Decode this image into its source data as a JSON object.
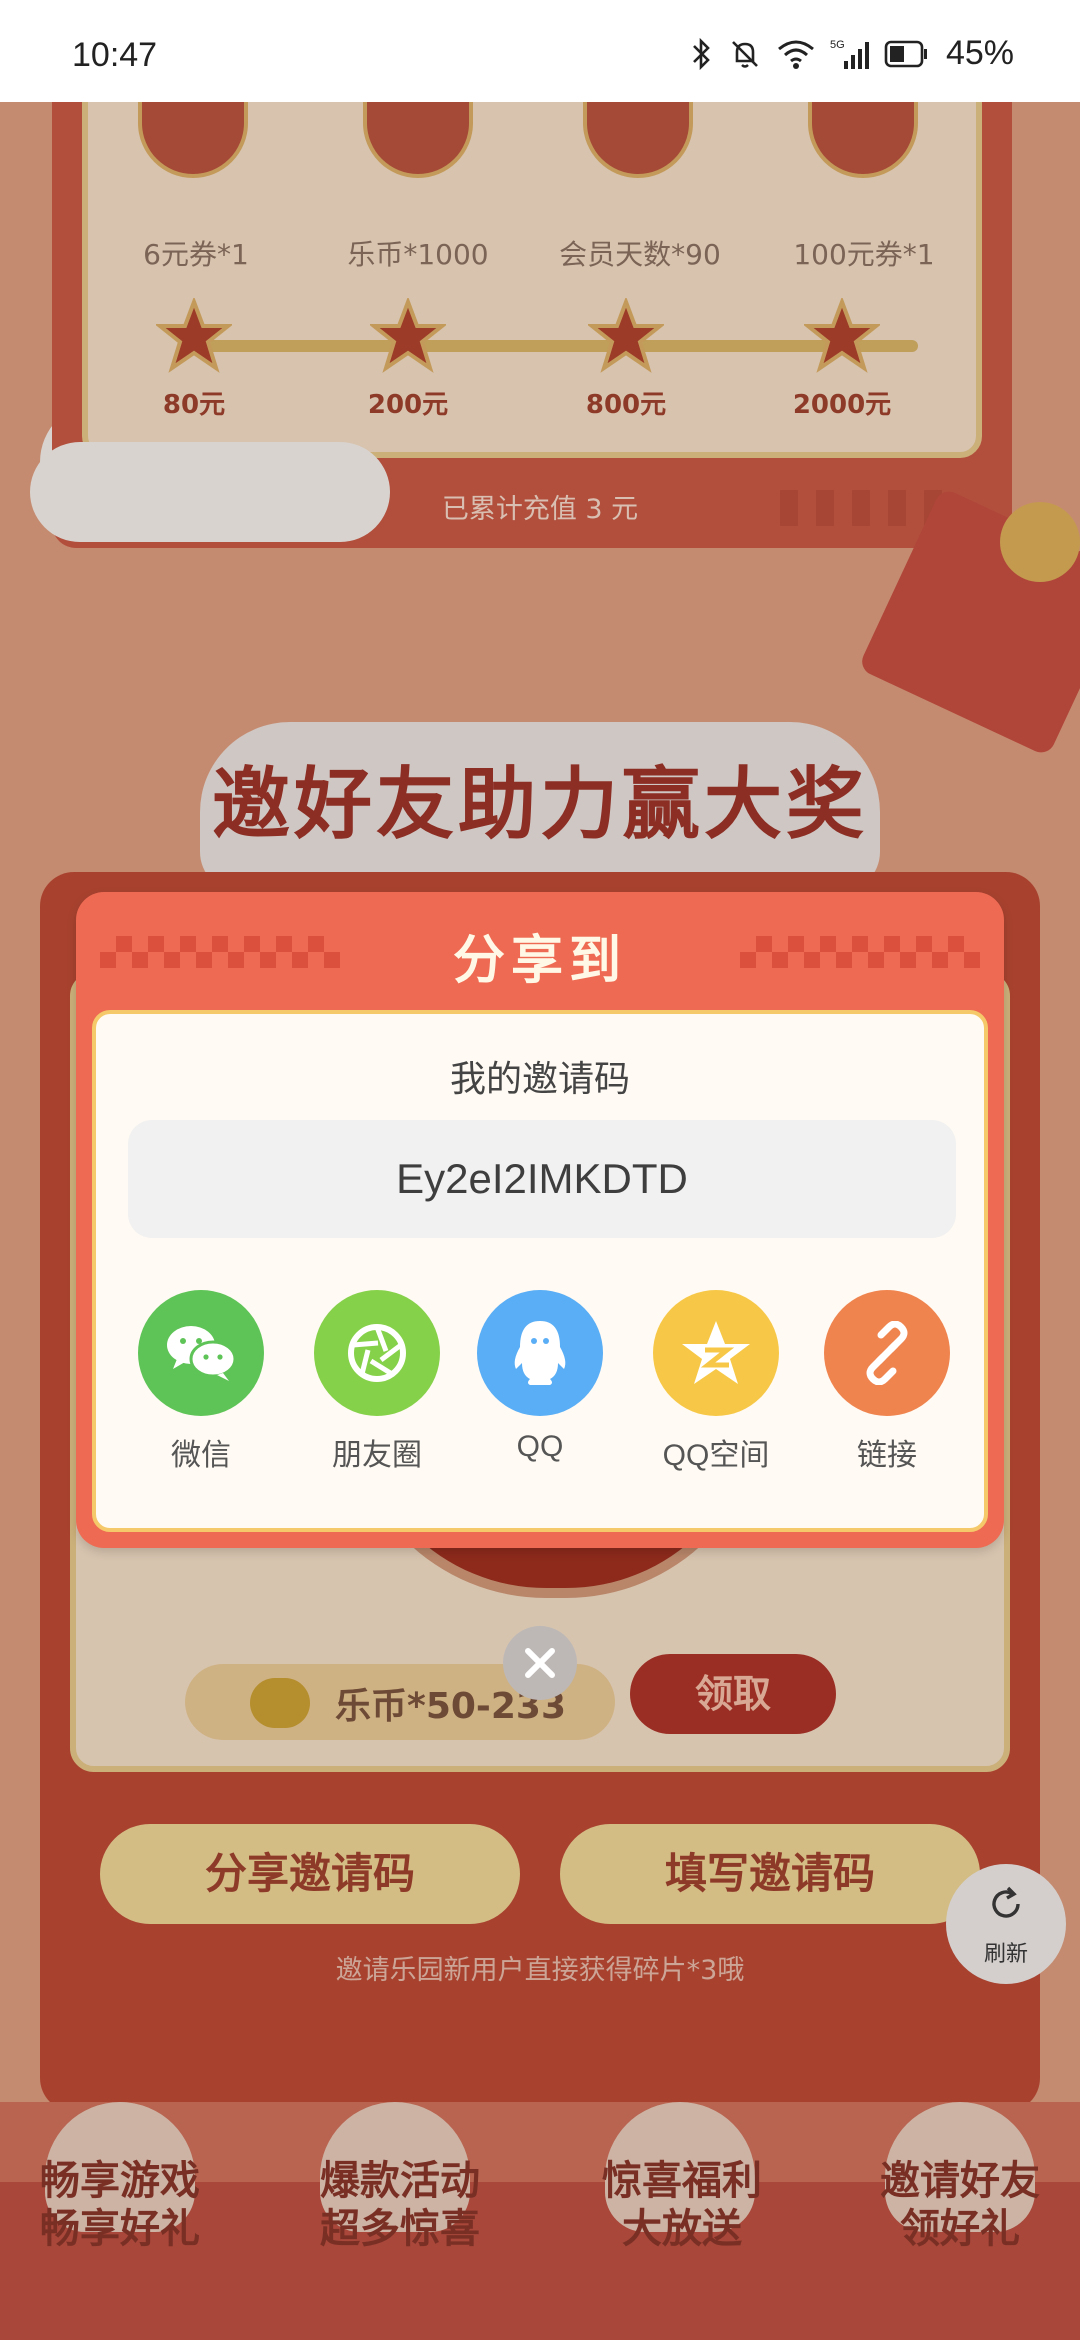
{
  "status_bar": {
    "time": "10:47",
    "battery": "45%",
    "network": "5G"
  },
  "background": {
    "rewards": [
      {
        "label": "6元券*1"
      },
      {
        "label": "乐币*1000"
      },
      {
        "label": "会员天数*90"
      },
      {
        "label": "100元券*1"
      }
    ],
    "milestones": [
      "80元",
      "200元",
      "800元",
      "2000元"
    ],
    "accumulated_text": "已累计充值 3 元",
    "section_title": "邀好友助力赢大奖",
    "coin_reward": "乐币*50-233",
    "claim_label": "领取",
    "share_code_button": "分享邀请码",
    "enter_code_button": "填写邀请码",
    "invite_hint": "邀请乐园新用户直接获得碎片*3哦",
    "refresh_label": "刷新",
    "features": [
      {
        "line1": "畅享游戏",
        "line2": "畅享好礼"
      },
      {
        "line1": "爆款活动",
        "line2": "超多惊喜"
      },
      {
        "line1": "惊喜福利",
        "line2": "大放送"
      },
      {
        "line1": "邀请好友",
        "line2": "领好礼"
      }
    ]
  },
  "share_dialog": {
    "title": "分享到",
    "code_label": "我的邀请码",
    "invite_code": "Ey2eI2IMKDTD",
    "targets": [
      {
        "label": "微信",
        "icon": "wechat-icon",
        "color": "#5fc458"
      },
      {
        "label": "朋友圈",
        "icon": "moments-icon",
        "color": "#86d14a"
      },
      {
        "label": "QQ",
        "icon": "qq-icon",
        "color": "#5aaef5"
      },
      {
        "label": "QQ空间",
        "icon": "qzone-icon",
        "color": "#f7c847"
      },
      {
        "label": "链接",
        "icon": "link-icon",
        "color": "#f0844f"
      }
    ]
  },
  "colors": {
    "dialog_header": "#ee6a52",
    "dialog_border": "#f5c96a",
    "dim_overlay": "#b9856c"
  }
}
